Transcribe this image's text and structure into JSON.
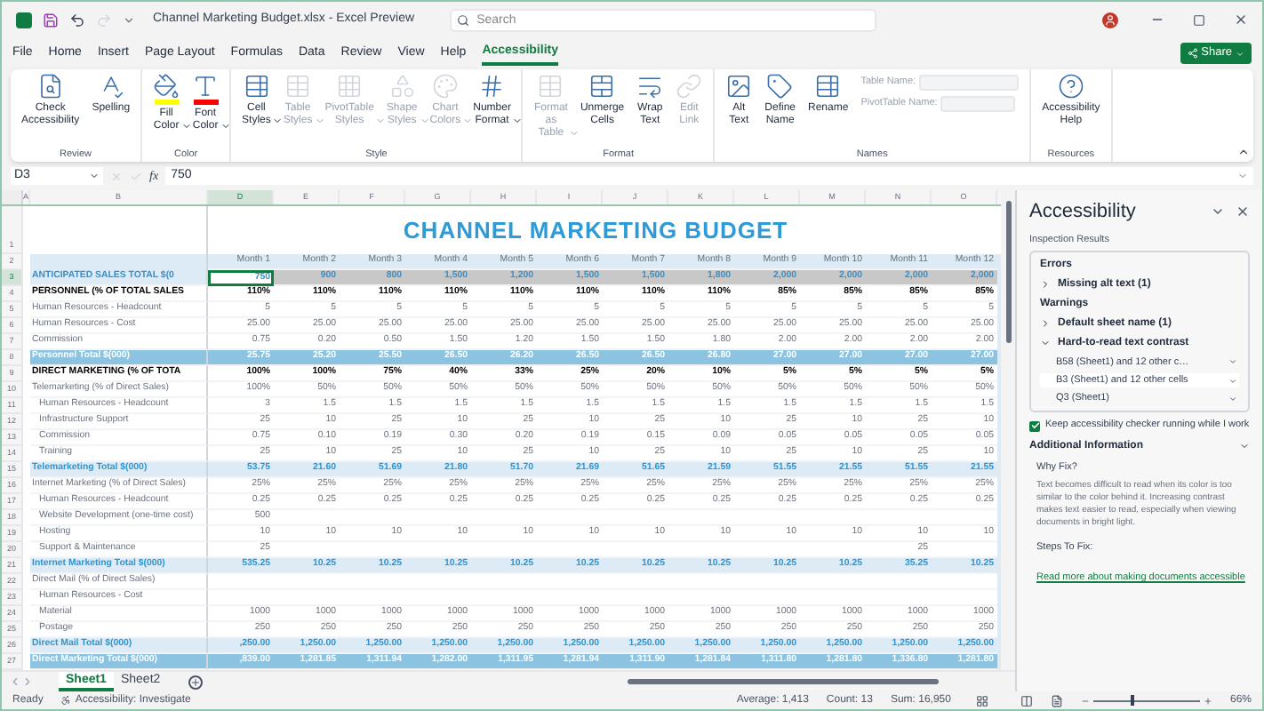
{
  "titlebar": {
    "title": "Channel Marketing Budget.xlsx - Excel Preview",
    "search": {
      "placeholder": "Search"
    }
  },
  "menu_tabs": [
    {
      "label": "File",
      "selected": false
    },
    {
      "label": "Home",
      "selected": false
    },
    {
      "label": "Insert",
      "selected": false
    },
    {
      "label": "Page Layout",
      "selected": false
    },
    {
      "label": "Formulas",
      "selected": false
    },
    {
      "label": "Data",
      "selected": false
    },
    {
      "label": "Review",
      "selected": false
    },
    {
      "label": "View",
      "selected": false
    },
    {
      "label": "Help",
      "selected": false
    },
    {
      "label": "Accessibility",
      "selected": true
    }
  ],
  "share_button": {
    "label": "Share"
  },
  "ribbon": {
    "groups": [
      {
        "label": "Review",
        "buttons": [
          {
            "kind": "button",
            "label": "Check Accessibility",
            "dropdown": false,
            "disabled": false
          },
          {
            "kind": "button",
            "label": "Spelling",
            "dropdown": false,
            "disabled": false
          }
        ]
      },
      {
        "label": "Color",
        "buttons": [
          {
            "kind": "color",
            "label": "Fill Color",
            "dropdown": true,
            "disabled": false,
            "color": "#ffff00"
          },
          {
            "kind": "color",
            "label": "Font Color",
            "dropdown": true,
            "disabled": false,
            "color": "#ff0000"
          }
        ]
      },
      {
        "label": "Style",
        "buttons": [
          {
            "kind": "button",
            "label": "Cell Styles",
            "dropdown": true,
            "disabled": false
          },
          {
            "kind": "button",
            "label": "Table Styles",
            "dropdown": true,
            "disabled": true
          },
          {
            "kind": "button",
            "label": "PivotTable Styles",
            "dropdown": true,
            "disabled": true
          },
          {
            "kind": "button",
            "label": "Shape Styles",
            "dropdown": true,
            "disabled": true
          },
          {
            "kind": "button",
            "label": "Chart Colors",
            "dropdown": true,
            "disabled": true
          },
          {
            "kind": "button",
            "label": "Number Format",
            "dropdown": true,
            "disabled": false
          }
        ]
      },
      {
        "label": "Format",
        "buttons": [
          {
            "kind": "button",
            "label": "Format as Table",
            "dropdown": true,
            "disabled": true
          },
          {
            "kind": "button",
            "label": "Unmerge Cells",
            "dropdown": false,
            "disabled": false
          },
          {
            "kind": "button",
            "label": "Wrap Text",
            "dropdown": false,
            "disabled": false
          },
          {
            "kind": "button",
            "label": "Edit Link",
            "dropdown": false,
            "disabled": true
          }
        ]
      },
      {
        "label": "Names",
        "buttons": [
          {
            "kind": "button",
            "label": "Alt Text",
            "dropdown": false,
            "disabled": false
          },
          {
            "kind": "button",
            "label": "Define Name",
            "dropdown": false,
            "disabled": false
          },
          {
            "kind": "button",
            "label": "Rename",
            "dropdown": false,
            "disabled": false
          },
          {
            "kind": "fields",
            "fields": [
              {
                "label": "Table Name:",
                "disabled": true
              },
              {
                "label": "PivotTable Name:",
                "disabled": true
              }
            ]
          }
        ]
      },
      {
        "label": "Resources",
        "buttons": [
          {
            "kind": "button",
            "label": "Accessibility Help",
            "dropdown": false,
            "disabled": false
          }
        ]
      }
    ]
  },
  "formula_bar": {
    "name_box": "D3",
    "function_label": "fx",
    "formula": "750"
  },
  "columns": [
    {
      "letter": "A",
      "selected": false
    },
    {
      "letter": "B",
      "selected": false
    },
    {
      "letter": "D",
      "selected": true
    },
    {
      "letter": "E",
      "selected": false
    },
    {
      "letter": "F",
      "selected": false
    },
    {
      "letter": "G",
      "selected": false
    },
    {
      "letter": "H",
      "selected": false
    },
    {
      "letter": "I",
      "selected": false
    },
    {
      "letter": "J",
      "selected": false
    },
    {
      "letter": "K",
      "selected": false
    },
    {
      "letter": "L",
      "selected": false
    },
    {
      "letter": "M",
      "selected": false
    },
    {
      "letter": "N",
      "selected": false
    },
    {
      "letter": "O",
      "selected": false
    }
  ],
  "rows": [
    {
      "num": "1",
      "kind": "title",
      "selected": false,
      "title": "CHANNEL MARKETING BUDGET"
    },
    {
      "num": "2",
      "kind": "header",
      "selected": false,
      "cells": [
        "Month 1",
        "Month 2",
        "Month 3",
        "Month 4",
        "Month 5",
        "Month 6",
        "Month 7",
        "Month 8",
        "Month 9",
        "Month 10",
        "Month 11",
        "Month 12"
      ]
    },
    {
      "num": "3",
      "kind": "sales",
      "selected": true,
      "label": "ANTICIPATED SALES TOTAL $(0",
      "cells": [
        "750",
        "900",
        "800",
        "1,500",
        "1,200",
        "1,500",
        "1,500",
        "1,800",
        "2,000",
        "2,000",
        "2,000",
        "2,000"
      ]
    },
    {
      "num": "4",
      "kind": "section",
      "selected": false,
      "label": "PERSONNEL (% OF TOTAL SALES",
      "cells": [
        "110%",
        "110%",
        "110%",
        "110%",
        "110%",
        "110%",
        "110%",
        "110%",
        "85%",
        "85%",
        "85%",
        "85%"
      ]
    },
    {
      "num": "5",
      "kind": "item",
      "selected": false,
      "label": "Human Resources - Headcount",
      "cells": [
        "5",
        "5",
        "5",
        "5",
        "5",
        "5",
        "5",
        "5",
        "5",
        "5",
        "5",
        "5"
      ]
    },
    {
      "num": "6",
      "kind": "item",
      "selected": false,
      "label": "Human Resources - Cost",
      "cells": [
        "25.00",
        "25.00",
        "25.00",
        "25.00",
        "25.00",
        "25.00",
        "25.00",
        "25.00",
        "25.00",
        "25.00",
        "25.00",
        "25.00"
      ]
    },
    {
      "num": "7",
      "kind": "item",
      "selected": false,
      "label": "Commission",
      "cells": [
        "0.75",
        "0.20",
        "0.50",
        "1.50",
        "1.20",
        "1.50",
        "1.50",
        "1.80",
        "2.00",
        "2.00",
        "2.00",
        "2.00"
      ]
    },
    {
      "num": "8",
      "kind": "total_dark",
      "selected": false,
      "label": "Personnel Total $(000)",
      "cells": [
        "25.75",
        "25.20",
        "25.50",
        "26.50",
        "26.20",
        "26.50",
        "26.50",
        "26.80",
        "27.00",
        "27.00",
        "27.00",
        "27.00"
      ]
    },
    {
      "num": "9",
      "kind": "section",
      "selected": false,
      "label": "DIRECT MARKETING (% OF TOTA",
      "cells": [
        "100%",
        "100%",
        "75%",
        "40%",
        "33%",
        "25%",
        "20%",
        "10%",
        "5%",
        "5%",
        "5%",
        "5%"
      ]
    },
    {
      "num": "10",
      "kind": "item",
      "selected": false,
      "label": "Telemarketing (% of Direct Sales)",
      "cells": [
        "100%",
        "50%",
        "50%",
        "50%",
        "50%",
        "50%",
        "50%",
        "50%",
        "50%",
        "50%",
        "50%",
        "50%"
      ]
    },
    {
      "num": "11",
      "kind": "indent",
      "selected": false,
      "label": "Human Resources - Headcount",
      "cells": [
        "3",
        "1.5",
        "1.5",
        "1.5",
        "1.5",
        "1.5",
        "1.5",
        "1.5",
        "1.5",
        "1.5",
        "1.5",
        "1.5"
      ]
    },
    {
      "num": "12",
      "kind": "indent",
      "selected": false,
      "label": "Infrastructure Support",
      "cells": [
        "25",
        "10",
        "25",
        "10",
        "25",
        "10",
        "25",
        "10",
        "25",
        "10",
        "25",
        "10"
      ]
    },
    {
      "num": "13",
      "kind": "indent",
      "selected": false,
      "label": "Commission",
      "cells": [
        "0.75",
        "0.10",
        "0.19",
        "0.30",
        "0.20",
        "0.19",
        "0.15",
        "0.09",
        "0.05",
        "0.05",
        "0.05",
        "0.05"
      ]
    },
    {
      "num": "14",
      "kind": "indent",
      "selected": false,
      "label": "Training",
      "cells": [
        "25",
        "10",
        "25",
        "10",
        "25",
        "10",
        "25",
        "10",
        "25",
        "10",
        "25",
        "10"
      ]
    },
    {
      "num": "15",
      "kind": "total_light",
      "selected": false,
      "label": "Telemarketing Total $(000)",
      "cells": [
        "53.75",
        "21.60",
        "51.69",
        "21.80",
        "51.70",
        "21.69",
        "51.65",
        "21.59",
        "51.55",
        "21.55",
        "51.55",
        "21.55"
      ]
    },
    {
      "num": "16",
      "kind": "item",
      "selected": false,
      "label": "Internet Marketing (% of Direct Sales)",
      "cells": [
        "25%",
        "25%",
        "25%",
        "25%",
        "25%",
        "25%",
        "25%",
        "25%",
        "25%",
        "25%",
        "25%",
        "25%"
      ]
    },
    {
      "num": "17",
      "kind": "indent",
      "selected": false,
      "label": "Human Resources - Headcount",
      "cells": [
        "0.25",
        "0.25",
        "0.25",
        "0.25",
        "0.25",
        "0.25",
        "0.25",
        "0.25",
        "0.25",
        "0.25",
        "0.25",
        "0.25"
      ]
    },
    {
      "num": "18",
      "kind": "indent",
      "selected": false,
      "label": "Website Development (one-time cost)",
      "cells": [
        "500",
        null,
        null,
        null,
        null,
        null,
        null,
        null,
        null,
        null,
        null,
        null
      ]
    },
    {
      "num": "19",
      "kind": "indent",
      "selected": false,
      "label": "Hosting",
      "cells": [
        "10",
        "10",
        "10",
        "10",
        "10",
        "10",
        "10",
        "10",
        "10",
        "10",
        "10",
        "10"
      ]
    },
    {
      "num": "20",
      "kind": "indent",
      "selected": false,
      "label": "Support & Maintenance",
      "cells": [
        "25",
        null,
        null,
        null,
        null,
        null,
        null,
        null,
        null,
        null,
        "25",
        null
      ]
    },
    {
      "num": "21",
      "kind": "total_light",
      "selected": false,
      "label": "Internet Marketing Total $(000)",
      "cells": [
        "535.25",
        "10.25",
        "10.25",
        "10.25",
        "10.25",
        "10.25",
        "10.25",
        "10.25",
        "10.25",
        "10.25",
        "35.25",
        "10.25"
      ]
    },
    {
      "num": "22",
      "kind": "item",
      "selected": false,
      "label": "Direct Mail (% of Direct Sales)",
      "cells": [
        null,
        null,
        null,
        null,
        null,
        null,
        null,
        null,
        null,
        null,
        null,
        null
      ]
    },
    {
      "num": "23",
      "kind": "indent",
      "selected": false,
      "label": "Human Resources - Cost",
      "cells": [
        null,
        null,
        null,
        null,
        null,
        null,
        null,
        null,
        null,
        null,
        null,
        null
      ]
    },
    {
      "num": "24",
      "kind": "indent",
      "selected": false,
      "label": "Material",
      "cells": [
        "1000",
        "1000",
        "1000",
        "1000",
        "1000",
        "1000",
        "1000",
        "1000",
        "1000",
        "1000",
        "1000",
        "1000"
      ]
    },
    {
      "num": "25",
      "kind": "indent",
      "selected": false,
      "label": "Postage",
      "cells": [
        "250",
        "250",
        "250",
        "250",
        "250",
        "250",
        "250",
        "250",
        "250",
        "250",
        "250",
        "250"
      ]
    },
    {
      "num": "26",
      "kind": "total_light",
      "selected": false,
      "label": "Direct Mail Total $(000)",
      "cells": [
        ",250.00",
        "1,250.00",
        "1,250.00",
        "1,250.00",
        "1,250.00",
        "1,250.00",
        "1,250.00",
        "1,250.00",
        "1,250.00",
        "1,250.00",
        "1,250.00",
        "1,250.00"
      ]
    },
    {
      "num": "27",
      "kind": "total_dark",
      "selected": false,
      "label": "Direct Marketing Total $(000)",
      "cells": [
        ",839.00",
        "1,281.85",
        "1,311.94",
        "1,282.00",
        "1,311.95",
        "1,281.94",
        "1,311.90",
        "1,281.84",
        "1,311.80",
        "1,281.80",
        "1,336.80",
        "1,281.80"
      ]
    }
  ],
  "sheet_tabs": [
    {
      "label": "Sheet1",
      "selected": true
    },
    {
      "label": "Sheet2",
      "selected": false
    }
  ],
  "pane": {
    "title": "Accessibility",
    "subtitle": "Inspection Results",
    "sections": [
      {
        "heading": "Errors",
        "items": [
          {
            "label": "Missing alt text (1)",
            "expanded": false
          }
        ]
      },
      {
        "heading": "Warnings",
        "items": [
          {
            "label": "Default sheet name (1)",
            "expanded": false
          },
          {
            "label": "Hard-to-read text contrast",
            "expanded": true,
            "children": [
              {
                "label": "B58 (Sheet1) and 12 other c…",
                "selected": false
              },
              {
                "label": "B3 (Sheet1) and 12 other cells",
                "selected": true
              },
              {
                "label": "Q3 (Sheet1)",
                "selected": false
              }
            ]
          }
        ]
      }
    ],
    "keep_running": {
      "label": "Keep accessibility checker running while I work",
      "checked": true
    },
    "additional": {
      "heading": "Additional Information",
      "expanded": true,
      "why_heading": "Why Fix?",
      "why_text": "Text becomes difficult to read when its color is too similar to the color behind it. Increasing contrast makes text easier to read, especially when viewing documents in bright light.",
      "steps_heading": "Steps To Fix:",
      "link": "Read more about making documents accessible"
    }
  },
  "status_bar": {
    "mode": "Ready",
    "accessibility": "Accessibility: Investigate",
    "average": "Average: 1,413",
    "count": "Count: 13",
    "sum": "Sum: 16,950",
    "zoom": {
      "level": 0.35,
      "reading": "66%"
    }
  }
}
